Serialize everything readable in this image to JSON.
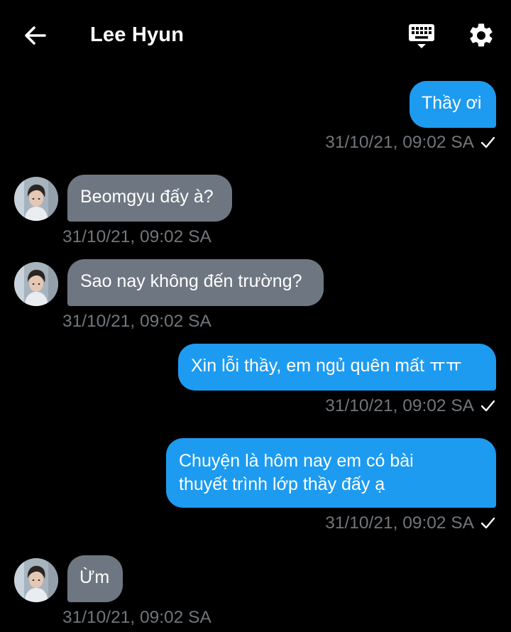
{
  "header": {
    "title": "Lee Hyun",
    "back_icon": "arrow-left-icon",
    "keyboard_icon": "keyboard-icon",
    "settings_icon": "gear-icon"
  },
  "colors": {
    "background": "#000000",
    "outgoing_bubble": "#1d9bf0",
    "incoming_bubble": "#6e7781",
    "timestamp": "#71767b"
  },
  "messages": [
    {
      "direction": "out",
      "text": "Thầy ơi",
      "timestamp": "31/10/21, 09:02 SA",
      "status": "sent"
    },
    {
      "direction": "in",
      "text": "Beomgyu đấy à?",
      "timestamp": "31/10/21, 09:02 SA"
    },
    {
      "direction": "in",
      "text": "Sao nay không đến trường?",
      "timestamp": "31/10/21, 09:02 SA"
    },
    {
      "direction": "out",
      "text": "Xin lỗi thầy, em ngủ quên mất ㅠㅠ",
      "timestamp": "31/10/21, 09:02 SA",
      "status": "sent"
    },
    {
      "direction": "out",
      "lines": [
        "Chuyện là hôm nay em có bài",
        "thuyết trình lớp thầy đấy ạ"
      ],
      "timestamp": "31/10/21, 09:02 SA",
      "status": "sent"
    },
    {
      "direction": "in",
      "text": "Ừm",
      "timestamp": "31/10/21, 09:02 SA"
    }
  ]
}
